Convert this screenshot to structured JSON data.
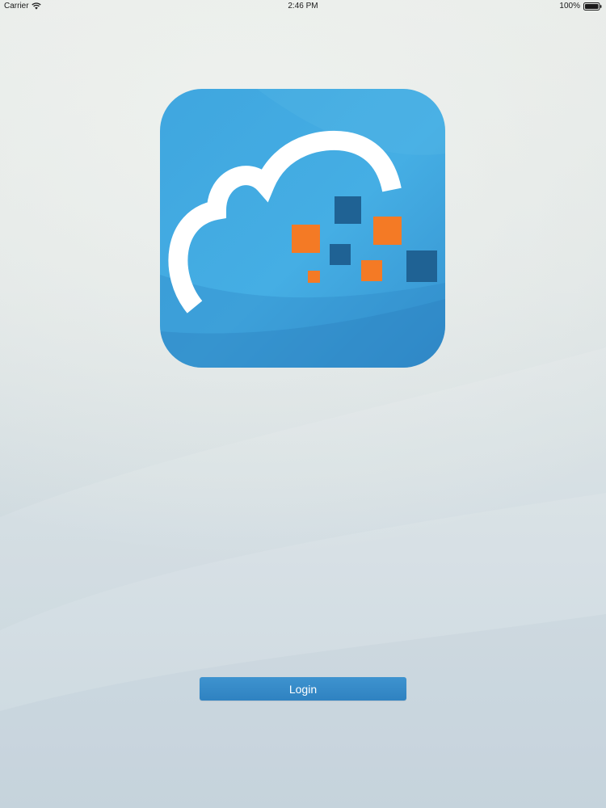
{
  "status_bar": {
    "carrier": "Carrier",
    "time": "2:46 PM",
    "battery": "100%",
    "wifi_icon": "wifi-icon",
    "battery_icon": "battery-icon"
  },
  "logo": {
    "icon": "cloud-data-logo",
    "colors": {
      "tile": "#3ea4dd",
      "cloud": "#ffffff",
      "orange": "#f47a25",
      "navy": "#1f6294"
    }
  },
  "login": {
    "label": "Login",
    "color": "#3389c8"
  }
}
